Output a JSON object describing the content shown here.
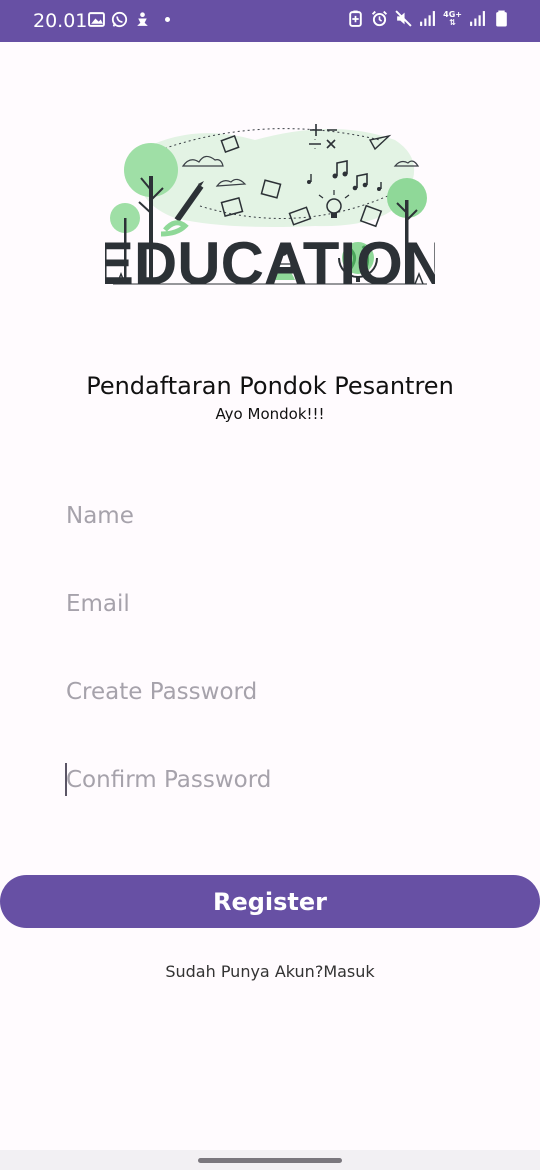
{
  "status_bar": {
    "time": "20.01",
    "network_type": "4G+",
    "colors": {
      "background": "#6750a4"
    },
    "icons": [
      "image-icon",
      "whatsapp-icon",
      "notification-icon",
      "battery-saver-icon",
      "alarm-icon",
      "mute-icon",
      "signal-icon",
      "battery-icon"
    ]
  },
  "hero": {
    "image_word": "EDUCATION",
    "icon": "education-illustration"
  },
  "header": {
    "title": "Pendaftaran Pondok Pesantren",
    "subtitle": "Ayo Mondok!!!"
  },
  "form": {
    "name": {
      "placeholder": "Name",
      "value": ""
    },
    "email": {
      "placeholder": "Email",
      "value": ""
    },
    "password": {
      "placeholder": "Create Password",
      "value": ""
    },
    "confirm_password": {
      "placeholder": "Confirm Password",
      "value": ""
    }
  },
  "actions": {
    "register_label": "Register",
    "login_prompt": "Sudah Punya Akun?Masuk",
    "colors": {
      "primary": "#6750a4"
    }
  }
}
